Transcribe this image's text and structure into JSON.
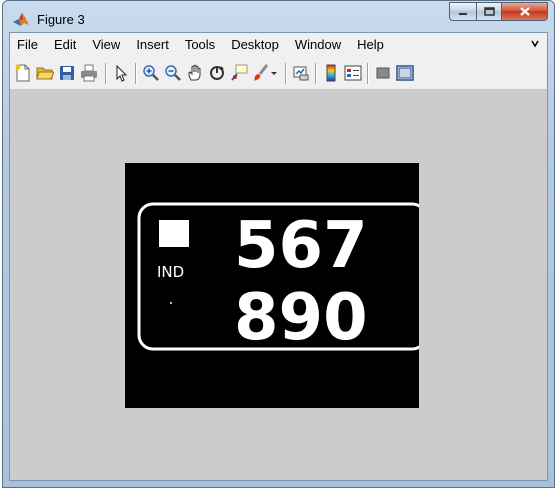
{
  "window": {
    "title": "Figure 3"
  },
  "menu": {
    "items": [
      "File",
      "Edit",
      "View",
      "Insert",
      "Tools",
      "Desktop",
      "Window",
      "Help"
    ],
    "overflow_icon": "chevron-icon"
  },
  "toolbar": {
    "tools": [
      "new-figure-icon",
      "open-file-icon",
      "save-figure-icon",
      "print-figure-icon",
      "edit-plot-icon",
      "zoom-in-icon",
      "zoom-out-icon",
      "pan-icon",
      "rotate-3d-icon",
      "data-cursor-icon",
      "brush-icon",
      "link-plot-icon",
      "insert-colorbar-icon",
      "insert-legend-icon",
      "hide-plot-tools-icon",
      "show-plot-tools-icon"
    ]
  },
  "image": {
    "description_hidden": "",
    "plate_line1": "567",
    "plate_line2": "890",
    "plate_country": "IND"
  },
  "colors": {
    "figure_bg": "#cccccc",
    "axes_bg": "#000000",
    "plate_fg": "#ffffff"
  }
}
